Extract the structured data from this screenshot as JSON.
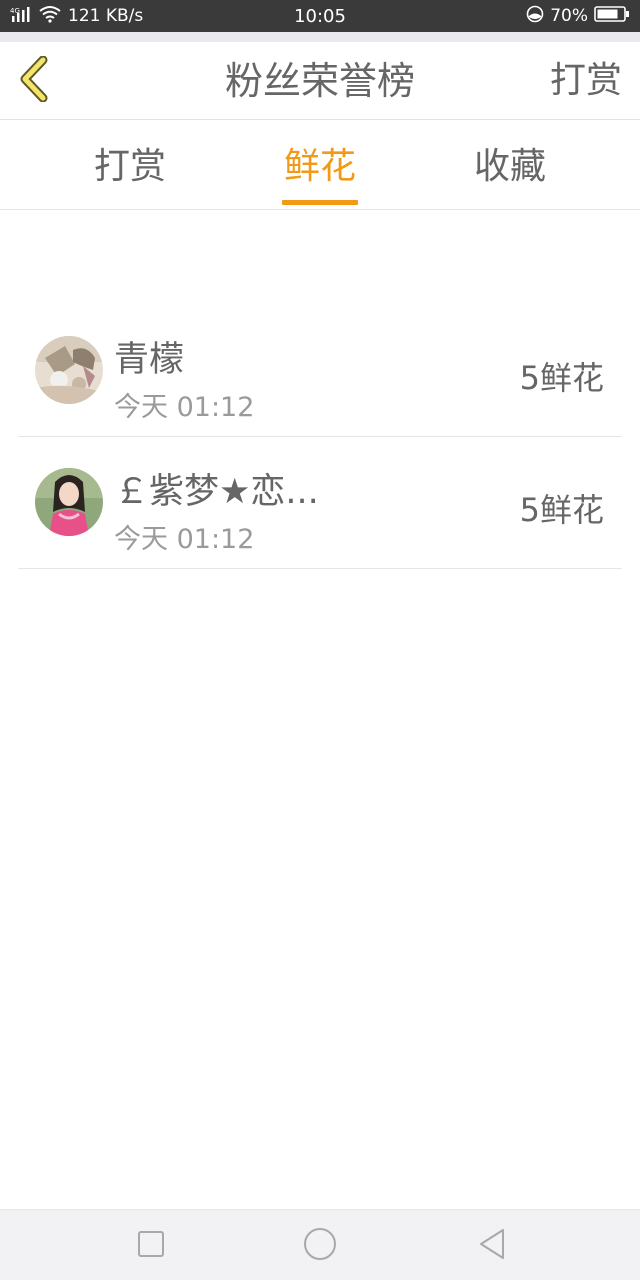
{
  "status_bar": {
    "network": "4G",
    "speed": "121 KB/s",
    "time": "10:05",
    "battery": "70%"
  },
  "header": {
    "title": "粉丝荣誉榜",
    "action_label": "打赏",
    "back_icon": "chevron-left-icon",
    "accent_color": "#f29a17"
  },
  "tabs": [
    {
      "label": "打赏",
      "active": false
    },
    {
      "label": "鲜花",
      "active": true
    },
    {
      "label": "收藏",
      "active": false
    }
  ],
  "list": [
    {
      "name": "青檬",
      "time": "今天 01:12",
      "value": "5鲜花"
    },
    {
      "name": "￡紫梦★恋...",
      "time": "今天 01:12",
      "value": "5鲜花"
    }
  ],
  "nav_bar": {
    "icons": [
      "square-icon",
      "circle-icon",
      "triangle-back-icon"
    ]
  }
}
